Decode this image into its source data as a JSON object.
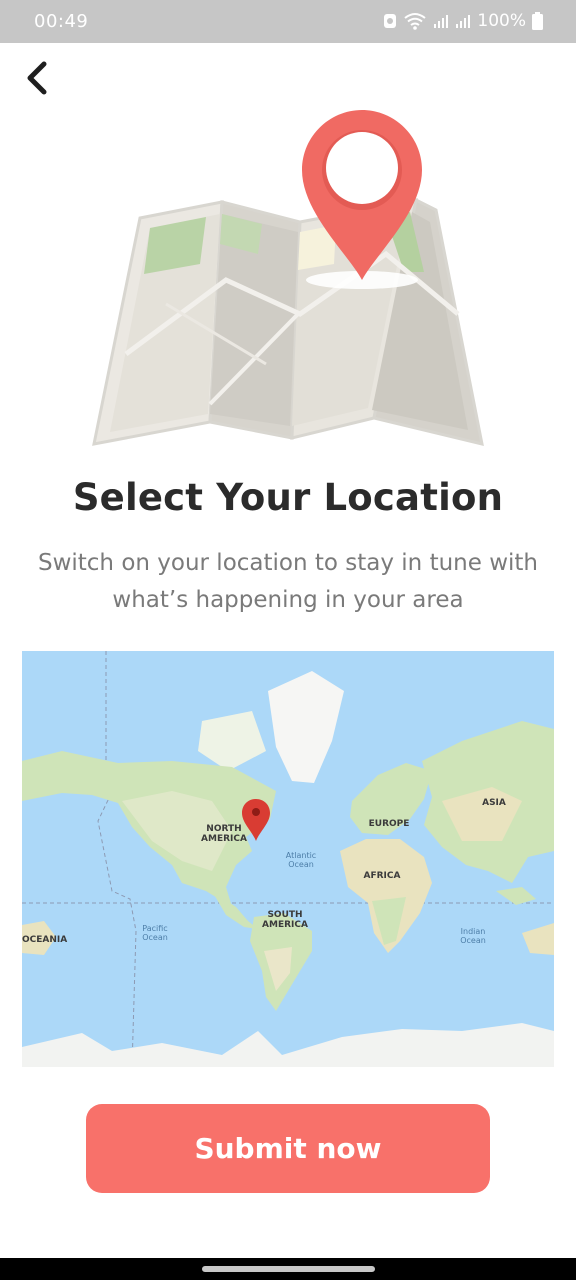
{
  "status_bar": {
    "time": "00:49",
    "battery": "100%",
    "icons": [
      "notification-icon",
      "wifi-icon",
      "signal-icon",
      "signal-icon",
      "battery-icon"
    ]
  },
  "nav": {
    "back_icon": "chevron-left-icon"
  },
  "hero": {
    "illustration": "folded-map-with-location-pin"
  },
  "content": {
    "title": "Select Your Location",
    "subtitle": "Switch on your location to stay in tune with what’s happening in your area"
  },
  "map": {
    "labels": {
      "north_america": "NORTH AMERICA",
      "south_america": "SOUTH AMERICA",
      "europe": "EUROPE",
      "africa": "AFRICA",
      "asia": "ASIA",
      "oceania": "OCEANIA",
      "atlantic": "Atlantic Ocean",
      "pacific": "Pacific Ocean",
      "indian": "Indian Ocean"
    },
    "marker_icon": "map-marker-icon"
  },
  "actions": {
    "submit_label": "Submit now"
  },
  "colors": {
    "accent": "#f8716a",
    "title": "#2b2b2b",
    "subtitle": "#7a7a7a",
    "ocean": "#acd8f8"
  }
}
